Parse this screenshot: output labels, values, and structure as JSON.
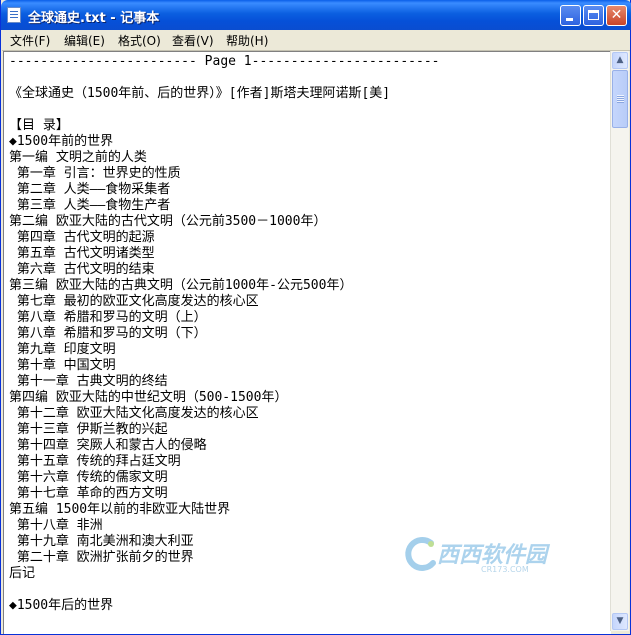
{
  "window": {
    "title": "全球通史.txt - 记事本",
    "controls": {
      "minimize": "_",
      "maximize": "□",
      "close": "✕"
    }
  },
  "menu": [
    {
      "label": "文件(F)"
    },
    {
      "label": "编辑(E)"
    },
    {
      "label": "格式(O)"
    },
    {
      "label": "查看(V)"
    },
    {
      "label": "帮助(H)"
    }
  ],
  "document": {
    "lines": [
      "------------------------ Page 1------------------------",
      "",
      "《全球通史（1500年前、后的世界）》[作者]斯塔夫理阿诺斯[美]",
      "",
      "【目 录】",
      "◆1500年前的世界",
      "第一编 文明之前的人类",
      " 第一章 引言：世界史的性质",
      " 第二章 人类——食物采集者",
      " 第三章 人类——食物生产者",
      "第二编 欧亚大陆的古代文明（公元前3500－1000年）",
      " 第四章 古代文明的起源",
      " 第五章 古代文明诸类型",
      " 第六章 古代文明的结束",
      "第三编 欧亚大陆的古典文明（公元前1000年-公元500年）",
      " 第七章 最初的欧亚文化高度发达的核心区",
      " 第八章 希腊和罗马的文明（上）",
      " 第八章 希腊和罗马的文明（下）",
      " 第九章 印度文明",
      " 第十章 中国文明",
      " 第十一章 古典文明的终结",
      "第四编 欧亚大陆的中世纪文明（500-1500年）",
      " 第十二章 欧亚大陆文化高度发达的核心区",
      " 第十三章 伊斯兰教的兴起",
      " 第十四章 突厥人和蒙古人的侵略",
      " 第十五章 传统的拜占廷文明",
      " 第十六章 传统的儒家文明",
      " 第十七章 革命的西方文明",
      "第五编 1500年以前的非欧亚大陆世界",
      " 第十八章 非洲",
      " 第十九章 南北美洲和澳大利亚",
      " 第二十章 欧洲扩张前夕的世界",
      "后记",
      "",
      "◆1500年后的世界"
    ]
  },
  "scrollbar": {
    "up_icon": "▲",
    "down_icon": "▼"
  },
  "watermark": {
    "text": "西西软件园",
    "sub": "CR173.COM"
  },
  "colors": {
    "titlebar": "#0a5fe0",
    "menubar": "#ece9d8",
    "editor_bg": "#ffffff"
  }
}
